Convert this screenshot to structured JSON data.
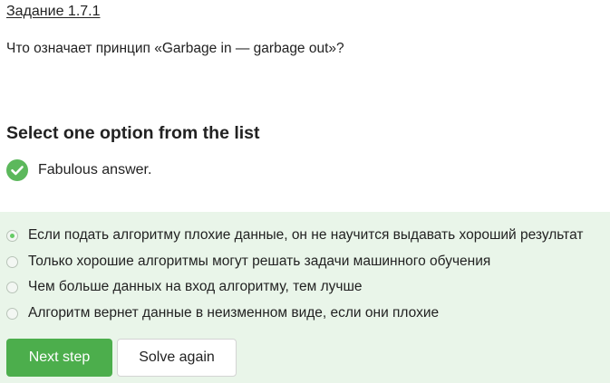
{
  "step": {
    "title": "Задание 1.7.1"
  },
  "question": {
    "text": "Что означает принцип «Garbage in — garbage out»?"
  },
  "quiz": {
    "title": "Select one option from the list",
    "feedback": {
      "text": "Fabulous answer.",
      "icon": "checkmark-circle-icon"
    }
  },
  "options": [
    {
      "label": "Если подать алгоритму плохие данные, он не научится выдавать хороший результат",
      "selected": true
    },
    {
      "label": "Только хорошие алгоритмы могут решать задачи машинного обучения",
      "selected": false
    },
    {
      "label": "Чем больше данных на вход алгоритму, тем лучше",
      "selected": false
    },
    {
      "label": "Алгоритм вернет данные в неизменном виде, если они плохие",
      "selected": false
    }
  ],
  "buttons": {
    "next_label": "Next step",
    "solve_again_label": "Solve again"
  },
  "colors": {
    "accent": "#4cae4c",
    "success_icon": "#5cb85c",
    "panel_bg": "#e9f5e9",
    "radio_selected": "#66cc66"
  }
}
